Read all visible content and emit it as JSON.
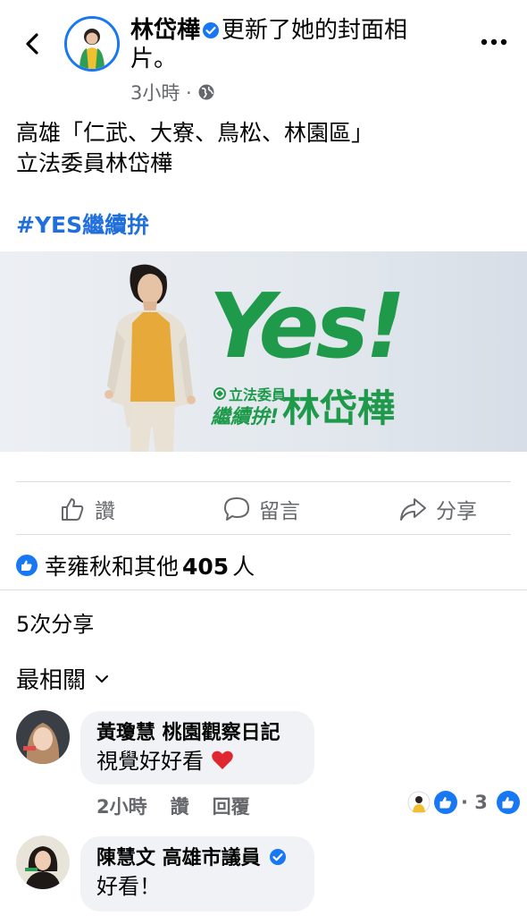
{
  "post": {
    "author": "林岱樺",
    "action": "更新了她的封面相片。",
    "time": "3小時 ·",
    "text_line1": "高雄「仁武、大寮、鳥松、林園區」",
    "text_line2": "立法委員林岱樺",
    "hashtag": "#YES繼續拚"
  },
  "banner": {
    "headline": "Yes!",
    "role": "立法委員",
    "slogan": "繼續拚!",
    "name": "林岱樺"
  },
  "actions": {
    "like": "讚",
    "comment": "留言",
    "share": "分享"
  },
  "reactions": {
    "text": "幸雍秋和其他",
    "count": "405",
    "suffix": "人"
  },
  "shares_text": "5次分享",
  "sort_label": "最相關",
  "comments": [
    {
      "author": "黃瓊慧 桃園觀察日記",
      "text": "視覺好好看",
      "time": "2小時",
      "like": "讚",
      "reply": "回覆",
      "reaction_count": "· 3"
    },
    {
      "author": "陳慧文 高雄市議員",
      "text": "好看！"
    }
  ],
  "colors": {
    "facebook_blue": "#1877f2",
    "banner_green": "#1f9a4b",
    "secondary_text": "#65676b"
  }
}
